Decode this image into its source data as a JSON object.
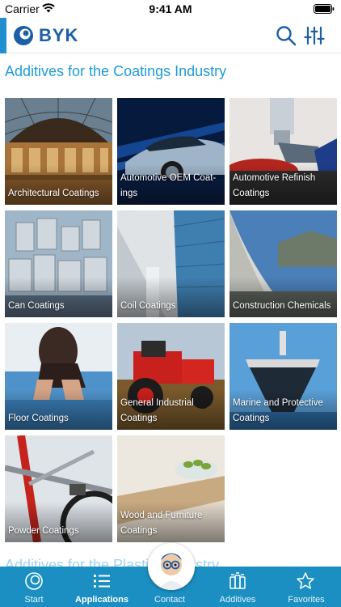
{
  "status_bar": {
    "carrier": "Carrier",
    "time": "9:41 AM"
  },
  "header": {
    "brand": "BYK",
    "accent_color": "#1f8fd0",
    "brand_color": "#1c5fa6"
  },
  "section": {
    "title": "Additives for the Coatings Industry"
  },
  "tiles": [
    {
      "label": "Architectural Coatings"
    },
    {
      "label": "Automotive OEM Coat-ings"
    },
    {
      "label": "Automotive Refinish Coatings"
    },
    {
      "label": "Can Coatings"
    },
    {
      "label": "Coil Coatings"
    },
    {
      "label": "Construction Chemicals"
    },
    {
      "label": "Floor Coatings"
    },
    {
      "label": "General Industrial Coatings"
    },
    {
      "label": "Marine and Protective Coatings"
    },
    {
      "label": "Powder Coatings"
    },
    {
      "label": "Wood and Furniture Coatings"
    }
  ],
  "next_section": {
    "title": "Additives for the Plastics Industry"
  },
  "tabbar": {
    "color": "#1b8fc1",
    "tabs": [
      {
        "label": "Start",
        "icon": "start-icon"
      },
      {
        "label": "Applications",
        "icon": "list-icon",
        "active": true
      },
      {
        "label": "Contact",
        "icon": "contact-avatar"
      },
      {
        "label": "Additives",
        "icon": "additives-icon"
      },
      {
        "label": "Favorites",
        "icon": "star-icon"
      }
    ]
  }
}
